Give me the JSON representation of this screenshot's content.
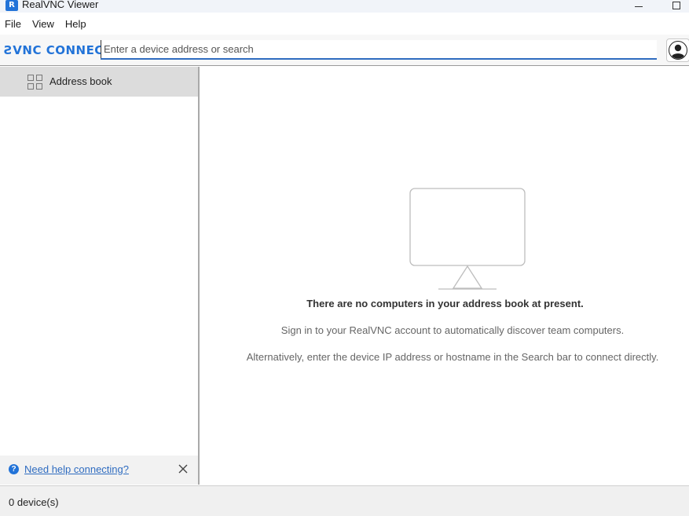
{
  "window": {
    "title": "RealVNC Viewer",
    "logo_letter": "R"
  },
  "menu": {
    "items": [
      "File",
      "View",
      "Help"
    ]
  },
  "toolbar": {
    "brand": "ƧVNC CONNECT",
    "search_placeholder": "Enter a device address or search",
    "search_value": ""
  },
  "sidebar": {
    "items": [
      {
        "label": "Address book",
        "icon": "grid-icon",
        "selected": true
      }
    ],
    "help_link": "Need help connecting?",
    "help_icon": "help-icon",
    "close_icon": "close-icon"
  },
  "main": {
    "empty_title": "There are no computers in your address book at present.",
    "empty_line1": "Sign in to your RealVNC account to automatically discover team computers.",
    "empty_line2": "Alternatively, enter the device IP address or hostname in the Search bar to connect directly.",
    "illustration": "monitor-icon"
  },
  "status": {
    "text": "0 device(s)"
  },
  "colors": {
    "accent": "#2273d8",
    "link": "#2f6cc0",
    "selected_bg": "#dcdcdc"
  }
}
